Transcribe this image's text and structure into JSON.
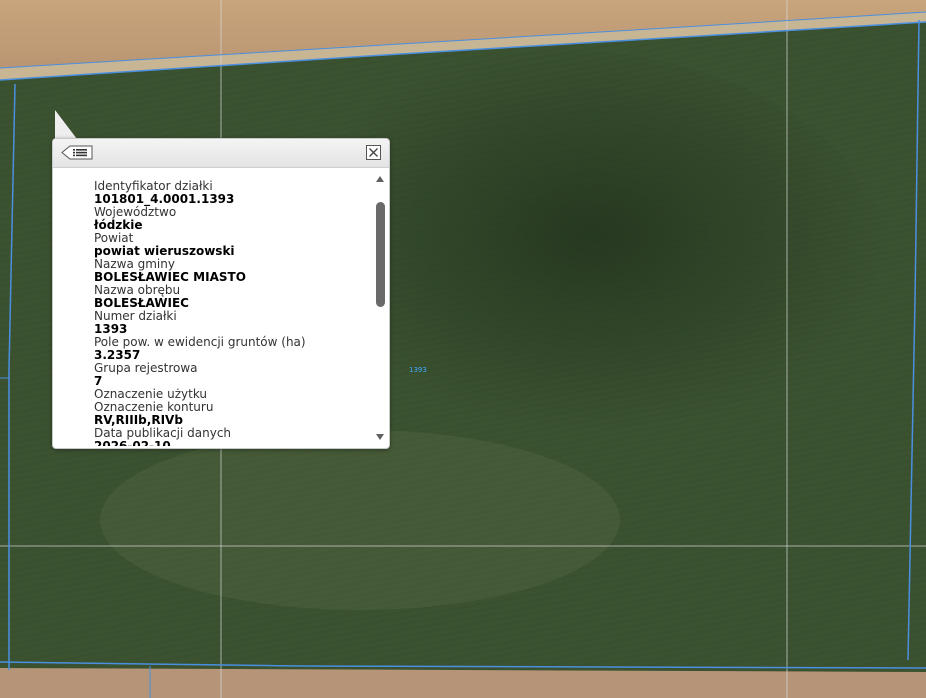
{
  "map": {
    "parcel_label": "1393",
    "colors": {
      "field": "#3b5230",
      "field_dark": "#2e4228",
      "crop_top": "#c6a27a",
      "crop_bottom": "#b59377",
      "road": "#d7c8b2",
      "parcel_boundary": "#4a8fe0",
      "grid_line": "#d8d8d8"
    }
  },
  "popup": {
    "menu_icon": "list-back-icon",
    "close_icon": "close-icon",
    "attributes": [
      {
        "name": "Identyfikator działki",
        "value": "101801_4.0001.1393"
      },
      {
        "name": "Województwo",
        "value": "łódzkie"
      },
      {
        "name": "Powiat",
        "value": "powiat wieruszowski"
      },
      {
        "name": "Nazwa gminy",
        "value": "BOLESŁAWIEC MIASTO"
      },
      {
        "name": "Nazwa obrębu",
        "value": "BOLESŁAWIEC"
      },
      {
        "name": "Numer działki",
        "value": "1393"
      },
      {
        "name": "Pole pow. w ewidencji gruntów (ha)",
        "value": "3.2357"
      },
      {
        "name": "Grupa rejestrowa",
        "value": "7"
      },
      {
        "name": "Oznaczenie użytku",
        "value": ""
      },
      {
        "name": "Oznaczenie konturu",
        "value": "RV,RIIIb,RIVb"
      },
      {
        "name": "Data publikacji danych",
        "value": "2026-02-10"
      }
    ]
  }
}
